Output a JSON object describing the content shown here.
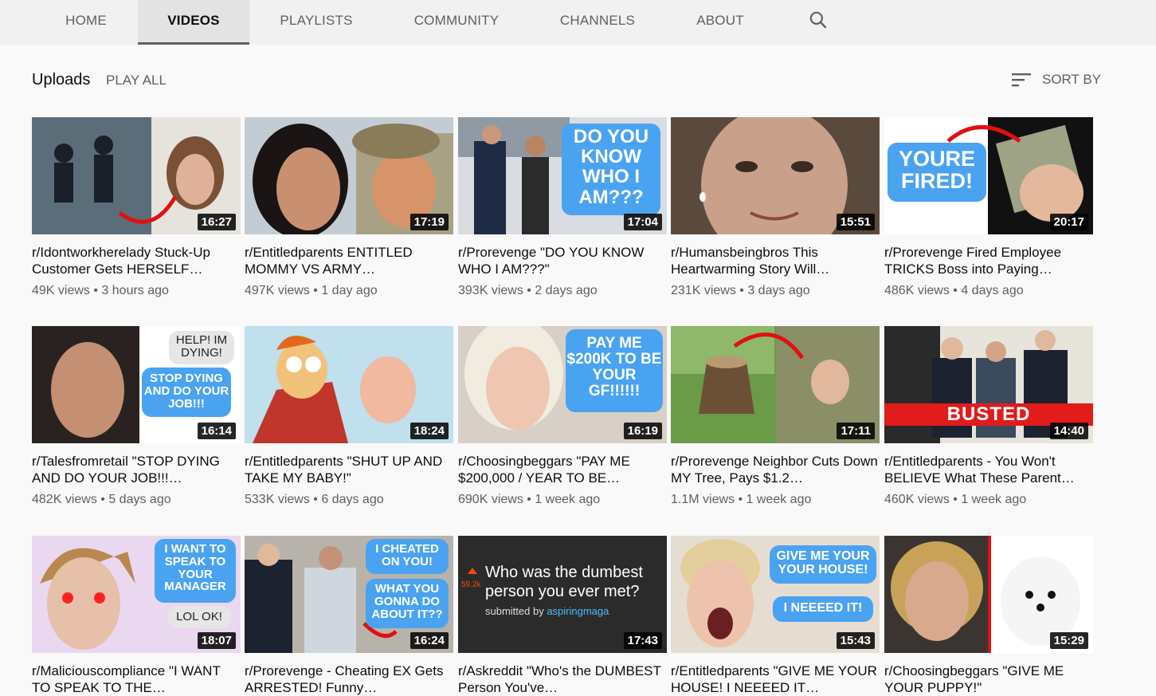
{
  "tabs": [
    {
      "label": "HOME",
      "active": false
    },
    {
      "label": "VIDEOS",
      "active": true
    },
    {
      "label": "PLAYLISTS",
      "active": false
    },
    {
      "label": "COMMUNITY",
      "active": false
    },
    {
      "label": "CHANNELS",
      "active": false
    },
    {
      "label": "ABOUT",
      "active": false
    }
  ],
  "toolbar": {
    "uploads_label": "Uploads",
    "play_all_label": "PLAY ALL",
    "sort_label": "SORT BY"
  },
  "videos": [
    {
      "duration": "16:27",
      "title": "r/Idontworkherelady Stuck-Up Customer Gets HERSELF…",
      "views": "49K views",
      "age": "3 hours ago"
    },
    {
      "duration": "17:19",
      "title": "r/Entitledparents ENTITLED MOMMY VS ARMY…",
      "views": "497K views",
      "age": "1 day ago"
    },
    {
      "duration": "17:04",
      "title": "r/Prorevenge \"DO YOU KNOW WHO I AM???\"",
      "views": "393K views",
      "age": "2 days ago"
    },
    {
      "duration": "15:51",
      "title": "r/Humansbeingbros This Heartwarming Story Will…",
      "views": "231K views",
      "age": "3 days ago"
    },
    {
      "duration": "20:17",
      "title": "r/Prorevenge Fired Employee TRICKS Boss into Paying…",
      "views": "486K views",
      "age": "4 days ago"
    },
    {
      "duration": "16:14",
      "title": "r/Talesfromretail \"STOP DYING AND DO YOUR JOB!!!…",
      "views": "482K views",
      "age": "5 days ago"
    },
    {
      "duration": "18:24",
      "title": "r/Entitledparents \"SHUT UP AND TAKE MY BABY!\"",
      "views": "533K views",
      "age": "6 days ago"
    },
    {
      "duration": "16:19",
      "title": "r/Choosingbeggars \"PAY ME $200,000 / YEAR TO BE…",
      "views": "690K views",
      "age": "1 week ago"
    },
    {
      "duration": "17:11",
      "title": "r/Prorevenge Neighbor Cuts Down MY Tree, Pays $1.2…",
      "views": "1.1M views",
      "age": "1 week ago"
    },
    {
      "duration": "14:40",
      "title": "r/Entitledparents - You Won't BELIEVE What These Parent…",
      "views": "460K views",
      "age": "1 week ago"
    },
    {
      "duration": "18:07",
      "title": "r/Maliciouscompliance \"I WANT TO SPEAK TO THE…",
      "views": "",
      "age": ""
    },
    {
      "duration": "16:24",
      "title": "r/Prorevenge - Cheating EX Gets ARRESTED! Funny…",
      "views": "",
      "age": ""
    },
    {
      "duration": "17:43",
      "title": "r/Askreddit \"Who's the DUMBEST Person You've…",
      "views": "",
      "age": ""
    },
    {
      "duration": "15:43",
      "title": "r/Entitledparents \"GIVE ME YOUR HOUSE! I NEEEED IT…",
      "views": "",
      "age": ""
    },
    {
      "duration": "15:29",
      "title": "r/Choosingbeggars \"GIVE ME YOUR PUPPY!\"",
      "views": "",
      "age": ""
    }
  ],
  "thumb_text": {
    "t3": "DO YOU KNOW WHO I AM???",
    "t5": "YOURE FIRED!",
    "t6a": "HELP! IM DYING!",
    "t6b": "STOP DYING AND DO YOUR JOB!!!",
    "t8": "PAY ME $200K TO BE YOUR GF!!!!!!",
    "t10": "BUSTED",
    "t11a": "I WANT TO SPEAK TO YOUR MANAGER",
    "t11b": "LOL OK!",
    "t12a": "I CHEATED ON YOU!",
    "t12b": "WHAT YOU GONNA DO ABOUT IT??",
    "t13_question": "Who was the dumbest person you ever met?",
    "t13_score": "59.2k",
    "t13_submitted": "submitted by",
    "t13_user": "aspiringmaga",
    "t14a": "GIVE ME YOUR YOUR HOUSE!",
    "t14b": "I NEEEED IT!"
  },
  "colors": {
    "tabbar_bg": "#f1f1f1",
    "page_bg": "#f9f9f9",
    "bubble_blue": "#4aa3f0",
    "busted_red": "#e21b1b"
  }
}
